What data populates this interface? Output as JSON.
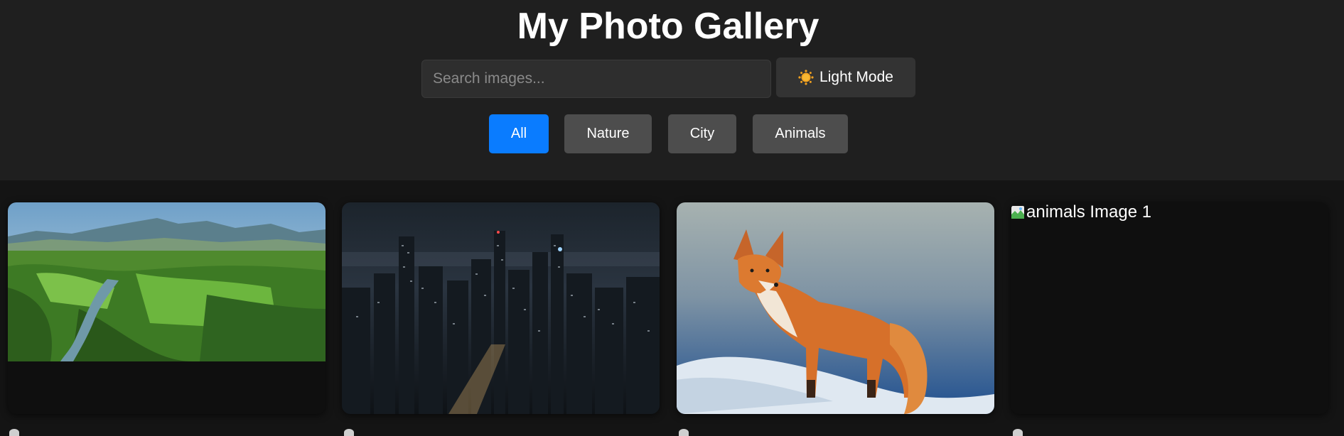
{
  "header": {
    "title": "My Photo Gallery",
    "search": {
      "placeholder": "Search images...",
      "value": ""
    },
    "mode_toggle": {
      "label": "Light Mode",
      "icon": "sun-icon"
    }
  },
  "filters": [
    {
      "label": "All",
      "active": true
    },
    {
      "label": "Nature",
      "active": false
    },
    {
      "label": "City",
      "active": false
    },
    {
      "label": "Animals",
      "active": false
    }
  ],
  "gallery": [
    {
      "category": "nature",
      "description": "river valley with forests and mountains"
    },
    {
      "category": "city",
      "description": "aerial city skyline at night"
    },
    {
      "category": "animals",
      "description": "red fox standing in snow"
    },
    {
      "category": "animals",
      "alt": "animals Image 1",
      "broken": true
    }
  ],
  "colors": {
    "header_bg": "#1f1f1f",
    "page_bg": "#141414",
    "active_filter": "#0a7cff",
    "inactive_filter": "#4d4d4d"
  }
}
